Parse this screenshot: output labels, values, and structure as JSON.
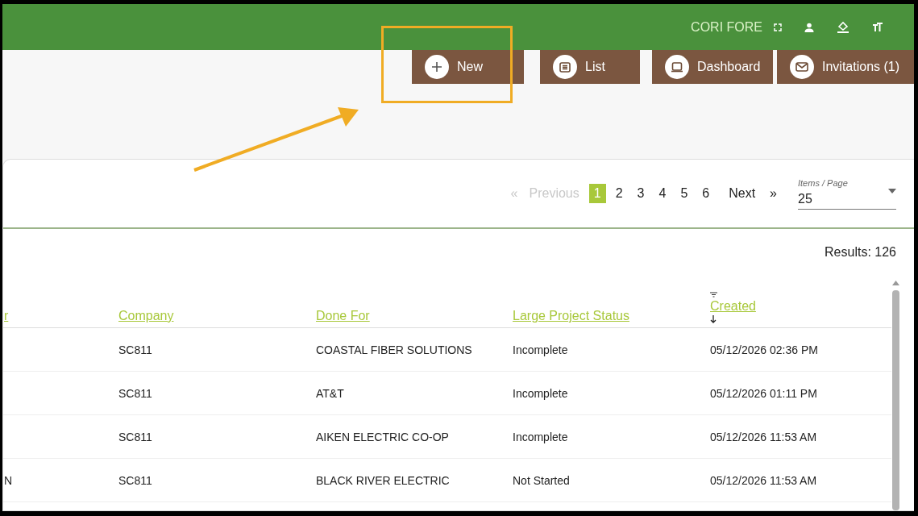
{
  "header": {
    "user_name": "CORI FORE"
  },
  "nav_buttons": [
    {
      "label": "New",
      "kind": "new",
      "highlighted": true
    },
    {
      "label": "List",
      "kind": "list"
    },
    {
      "label": "Dashboard",
      "kind": "dashboard"
    },
    {
      "label": "Invitations (1)",
      "kind": "invitations"
    }
  ],
  "pagination": {
    "previous": "Previous",
    "previous_arrow": "«",
    "pages": [
      {
        "label": "1",
        "selected": true
      },
      {
        "label": "2",
        "selected": false
      },
      {
        "label": "3",
        "selected": false
      },
      {
        "label": "4",
        "selected": false
      },
      {
        "label": "5",
        "selected": false
      },
      {
        "label": "6",
        "selected": false
      }
    ],
    "next": "Next",
    "next_arrow": "»",
    "items_per_page": {
      "label": "Items / Page",
      "value": "25"
    }
  },
  "results": "Results: 126",
  "table": {
    "columns": [
      {
        "label": "r"
      },
      {
        "label": "Company"
      },
      {
        "label": "Done For"
      },
      {
        "label": "Large Project Status"
      },
      {
        "label": "Created",
        "sorted": true
      }
    ],
    "rows": [
      {
        "company": "SC811",
        "done_for": "COASTAL FIBER SOLUTIONS",
        "status": "Incomplete",
        "created": "05/12/2026 02:36 PM"
      },
      {
        "company": "SC811",
        "done_for": "AT&T",
        "status": "Incomplete",
        "created": "05/12/2026 01:11 PM"
      },
      {
        "company": "SC811",
        "done_for": "AIKEN ELECTRIC CO-OP",
        "status": "Incomplete",
        "created": "05/12/2026 11:53 AM"
      },
      {
        "column_1": "N",
        "company": "SC811",
        "done_for": "BLACK RIVER ELECTRIC",
        "status": "Not Started",
        "created": "05/12/2026 11:53 AM"
      }
    ]
  }
}
